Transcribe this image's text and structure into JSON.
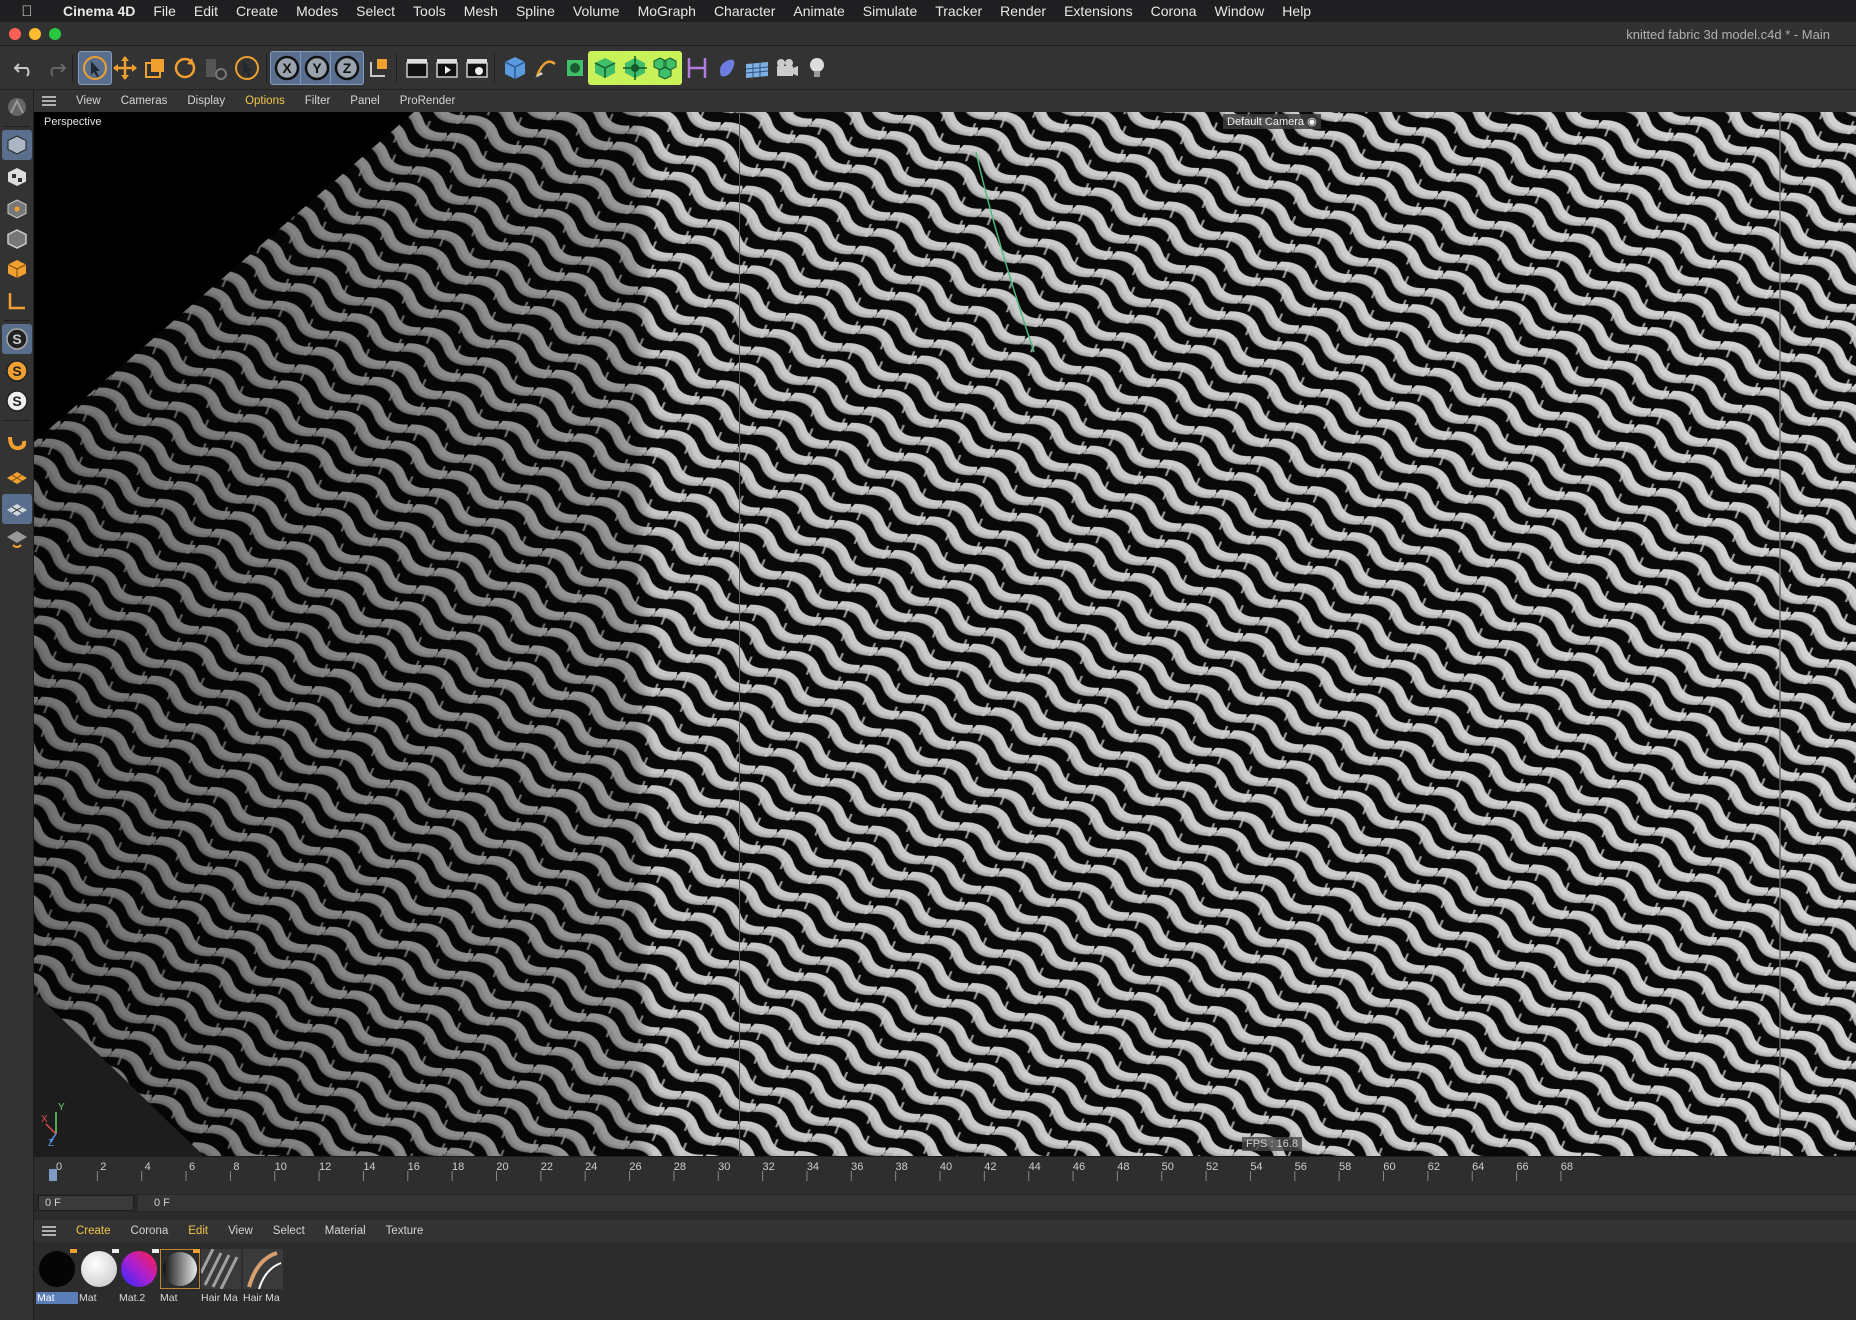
{
  "menubar": {
    "app": "Cinema 4D",
    "items": [
      "File",
      "Edit",
      "Create",
      "Modes",
      "Select",
      "Tools",
      "Mesh",
      "Spline",
      "Volume",
      "MoGraph",
      "Character",
      "Animate",
      "Simulate",
      "Tracker",
      "Render",
      "Extensions",
      "Corona",
      "Window",
      "Help"
    ]
  },
  "window": {
    "title": "knitted fabric 3d model.c4d * - Main"
  },
  "viewport_menu": {
    "items": [
      "View",
      "Cameras",
      "Display",
      "Options",
      "Filter",
      "Panel",
      "ProRender"
    ],
    "active": "Options"
  },
  "viewport": {
    "label": "Perspective",
    "camera": "Default Camera",
    "fps": "FPS : 16.8",
    "axes": {
      "x": "X",
      "y": "Y",
      "z": "Z"
    }
  },
  "timeline": {
    "ticks": [
      "0",
      "2",
      "4",
      "6",
      "8",
      "10",
      "12",
      "14",
      "16",
      "18",
      "20",
      "22",
      "24",
      "26",
      "28",
      "30",
      "32",
      "34",
      "36",
      "38",
      "40",
      "42",
      "44",
      "46",
      "48",
      "50",
      "52",
      "54",
      "56",
      "58",
      "60",
      "62",
      "64",
      "66",
      "68"
    ],
    "current_frame": "0 F",
    "end_frame": "0 F"
  },
  "material_menu": {
    "items": [
      "Create",
      "Corona",
      "Edit",
      "View",
      "Select",
      "Material",
      "Texture"
    ],
    "highlight": [
      "Create",
      "Edit"
    ]
  },
  "materials": [
    {
      "name": "Mat",
      "kind": "black",
      "selected": true
    },
    {
      "name": "Mat",
      "kind": "white",
      "selected": false
    },
    {
      "name": "Mat.2",
      "kind": "gradient",
      "selected": false
    },
    {
      "name": "Mat",
      "kind": "grey",
      "selected": false
    },
    {
      "name": "Hair Ma",
      "kind": "hair",
      "selected": false
    },
    {
      "name": "Hair Ma",
      "kind": "hair2",
      "selected": false
    }
  ],
  "colors": {
    "accent_selected": "#5a6f8e",
    "menu_active": "#f2c54a",
    "highlight_green": "#c9f15a"
  }
}
